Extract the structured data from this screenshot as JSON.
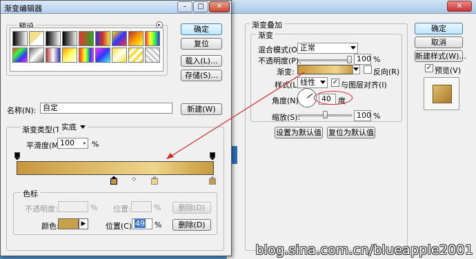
{
  "gradient_editor": {
    "title": "渐变编辑器",
    "presets_legend": "预设",
    "ok": "确定",
    "reset": "复位",
    "load": "载入(L)...",
    "save": "存储(S)...",
    "name_label": "名称(N):",
    "name_value": "自定",
    "new": "新建(W)",
    "type_label": "渐变类型(T):",
    "type_value": "实底",
    "smooth_label": "平滑度(M):",
    "smooth_value": "100",
    "smooth_unit": "%",
    "stops_legend": "色标",
    "opacity_label": "不透明度:",
    "opacity_unit": "%",
    "location_label_top": "位置:",
    "location_unit_top": "%",
    "delete_top": "删除(D)",
    "color_label": "颜色:",
    "location_label": "位置(C):",
    "location_value": "49",
    "location_unit": "%",
    "delete": "删除(D)",
    "stop_color": "#c9a04a"
  },
  "layer_style": {
    "section_title": "渐变叠加",
    "group_title": "渐变",
    "blend_label": "混合模式(O):",
    "blend_value": "正常",
    "opacity_label": "不透明度(P):",
    "opacity_value": "100",
    "opacity_unit": "%",
    "opacity_level": 1.0,
    "gradient_label": "渐变:",
    "reverse_label": "反向(R)",
    "style_label": "样式(L):",
    "style_value": "线性",
    "align_label": "与图层对齐(I)",
    "angle_label": "角度(N):",
    "angle_value": "40",
    "angle_unit": "度",
    "scale_label": "缩放(S):",
    "scale_value": "100",
    "scale_unit": "%",
    "scale_level": 0.5,
    "set_default": "设置为默认值",
    "reset_default": "复位为默认值",
    "ok": "确定",
    "cancel": "取消",
    "new_style": "新建样式(W)...",
    "preview_label": "预览(V)"
  },
  "watermark": "blog.sina.com.cn/blueapple2001"
}
